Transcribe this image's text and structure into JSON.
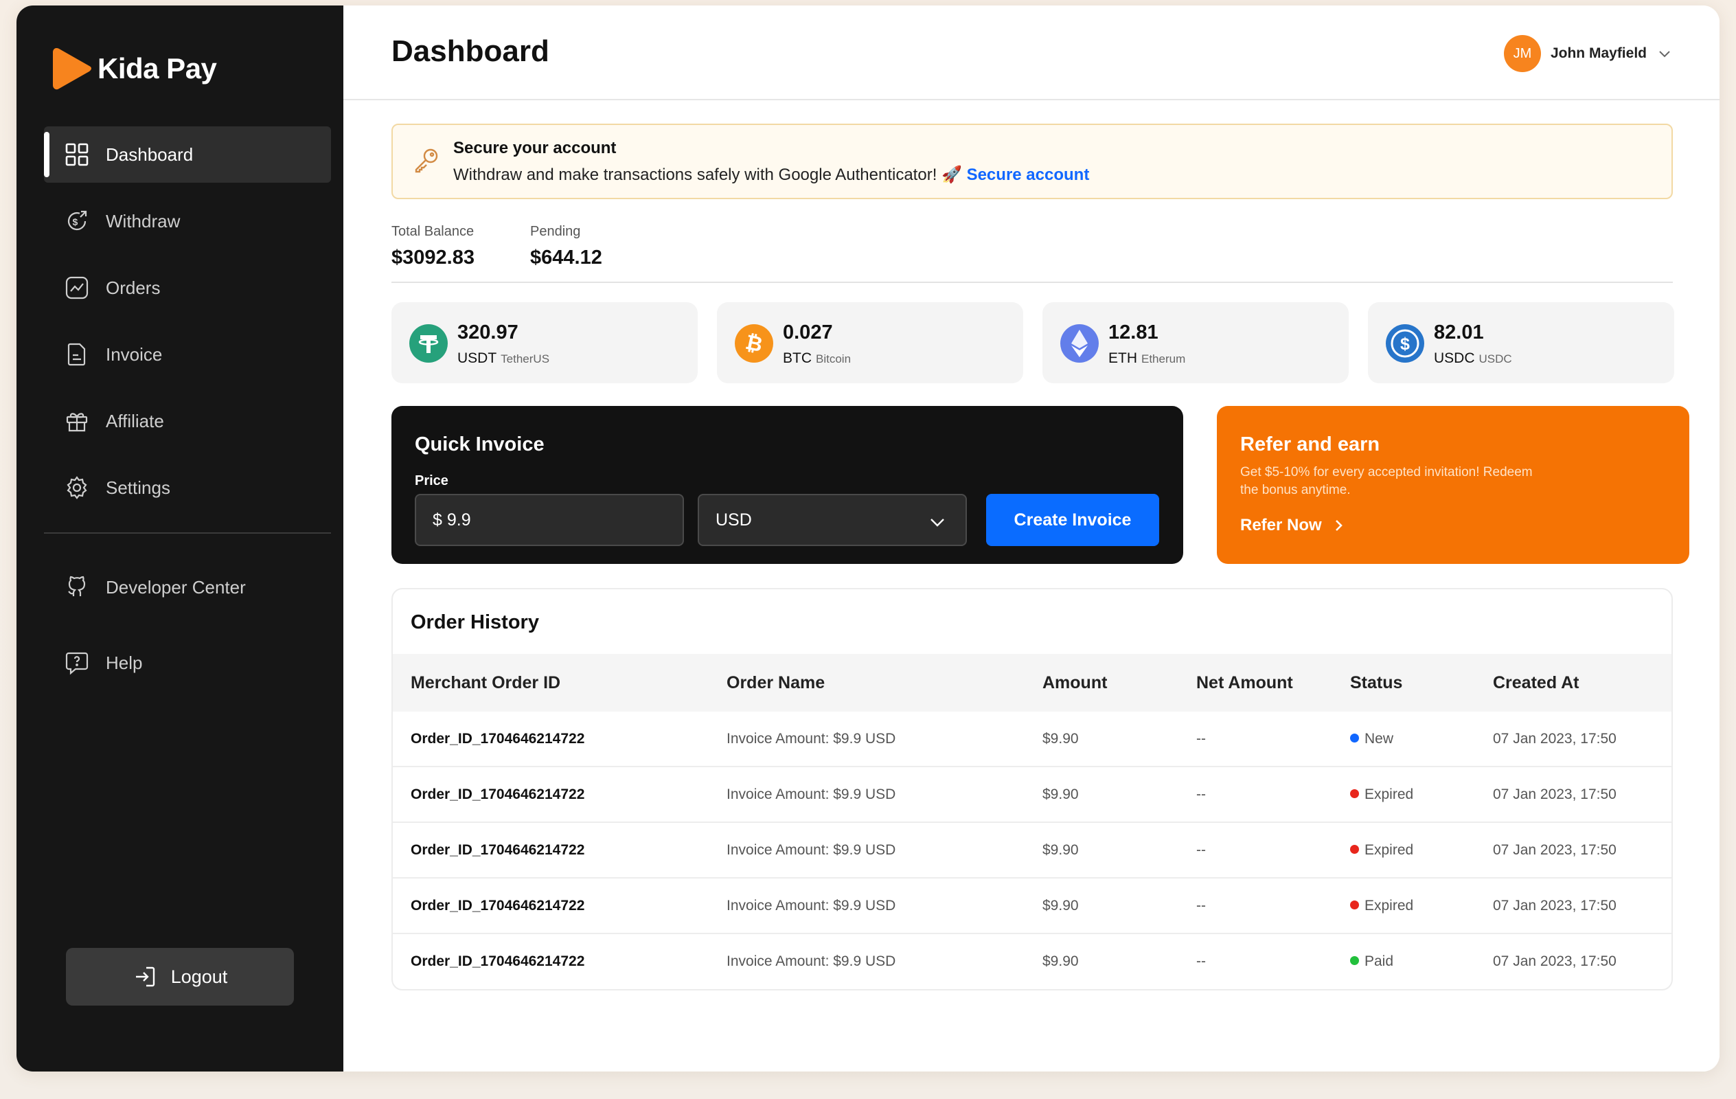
{
  "app": {
    "name": "Kida Pay"
  },
  "sidebar": {
    "items": [
      {
        "label": "Dashboard",
        "icon": "dashboard-grid-icon",
        "active": true
      },
      {
        "label": "Withdraw",
        "icon": "withdraw-dollar-icon"
      },
      {
        "label": "Orders",
        "icon": "orders-chart-icon"
      },
      {
        "label": "Invoice",
        "icon": "invoice-document-icon"
      },
      {
        "label": "Affiliate",
        "icon": "affiliate-gift-icon"
      },
      {
        "label": "Settings",
        "icon": "settings-gear-icon"
      }
    ],
    "secondary": [
      {
        "label": "Developer Center",
        "icon": "github-icon"
      },
      {
        "label": "Help",
        "icon": "help-chat-icon"
      }
    ],
    "logout_label": "Logout"
  },
  "header": {
    "title": "Dashboard",
    "user": {
      "initials": "JM",
      "name": "John Mayfield"
    }
  },
  "alert": {
    "title": "Secure your account",
    "text": "Withdraw and make transactions safely with Google Authenticator! 🚀",
    "link": "Secure account"
  },
  "balance": {
    "total_label": "Total Balance",
    "total_value": "$3092.83",
    "pending_label": "Pending",
    "pending_value": "$644.12"
  },
  "coins": [
    {
      "amount": "320.97",
      "symbol": "USDT",
      "name": "TetherUS",
      "color": "#26a17b",
      "icon": "tether-icon"
    },
    {
      "amount": "0.027",
      "symbol": "BTC",
      "name": "Bitcoin",
      "color": "#f7931a",
      "icon": "bitcoin-icon"
    },
    {
      "amount": "12.81",
      "symbol": "ETH",
      "name": "Etherum",
      "color": "#627eea",
      "icon": "ethereum-icon"
    },
    {
      "amount": "82.01",
      "symbol": "USDC",
      "name": "USDC",
      "color": "#2775ca",
      "icon": "usdc-icon"
    }
  ],
  "quick_invoice": {
    "title": "Quick Invoice",
    "price_label": "Price",
    "price_value": "$ 9.9",
    "currency": "USD",
    "button": "Create Invoice"
  },
  "refer": {
    "title": "Refer and earn",
    "text": "Get $5-10% for every accepted invitation! Redeem the bonus anytime.",
    "button": "Refer Now"
  },
  "orders": {
    "title": "Order History",
    "columns": [
      "Merchant Order ID",
      "Order Name",
      "Amount",
      "Net Amount",
      "Status",
      "Created At"
    ],
    "rows": [
      {
        "id": "Order_ID_1704646214722",
        "name": "Invoice Amount: $9.9 USD",
        "amount": "$9.90",
        "net": "--",
        "status": "New",
        "status_color": "#1167ff",
        "created": "07 Jan 2023, 17:50"
      },
      {
        "id": "Order_ID_1704646214722",
        "name": "Invoice Amount: $9.9 USD",
        "amount": "$9.90",
        "net": "--",
        "status": "Expired",
        "status_color": "#e8261c",
        "created": "07 Jan 2023, 17:50"
      },
      {
        "id": "Order_ID_1704646214722",
        "name": "Invoice Amount: $9.9 USD",
        "amount": "$9.90",
        "net": "--",
        "status": "Expired",
        "status_color": "#e8261c",
        "created": "07 Jan 2023, 17:50"
      },
      {
        "id": "Order_ID_1704646214722",
        "name": "Invoice Amount: $9.9 USD",
        "amount": "$9.90",
        "net": "--",
        "status": "Expired",
        "status_color": "#e8261c",
        "created": "07 Jan 2023, 17:50"
      },
      {
        "id": "Order_ID_1704646214722",
        "name": "Invoice Amount: $9.9 USD",
        "amount": "$9.90",
        "net": "--",
        "status": "Paid",
        "status_color": "#22c03c",
        "created": "07 Jan 2023, 17:50"
      }
    ]
  }
}
